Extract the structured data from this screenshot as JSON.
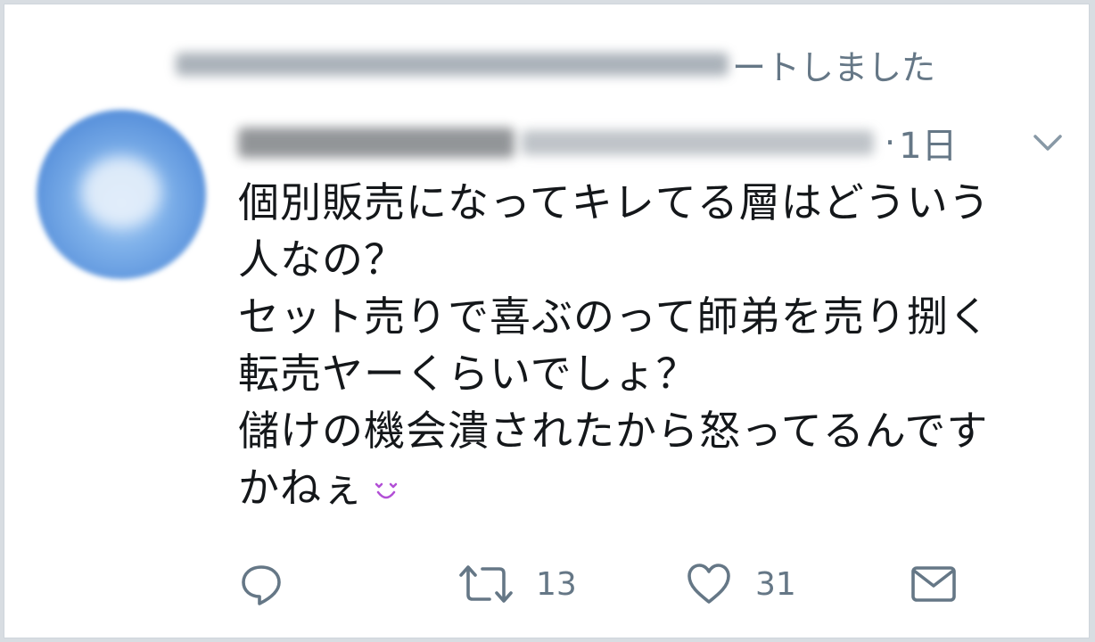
{
  "retweet_header": {
    "text": "ートしました",
    "icon": "retweet-small-icon"
  },
  "tweet": {
    "separator": "·",
    "timestamp": "1日",
    "text_lines": [
      "個別販売になってキレてる層はどういう",
      "人なの？",
      "セット売りで喜ぶのって師弟を売り捌く",
      "転売ヤーくらいでしょ？",
      "儲けの機会潰されたから怒ってるんです",
      "かねぇ"
    ],
    "emoji": "heart-eyes-emoji"
  },
  "actions": {
    "reply": {
      "icon": "reply-icon"
    },
    "retweet": {
      "icon": "retweet-icon",
      "count": "13"
    },
    "like": {
      "icon": "heart-icon",
      "count": "31"
    },
    "dm": {
      "icon": "envelope-icon"
    }
  },
  "colors": {
    "text_primary": "#14171a",
    "text_secondary": "#657786",
    "emoji_accent": "#b24fd6"
  }
}
